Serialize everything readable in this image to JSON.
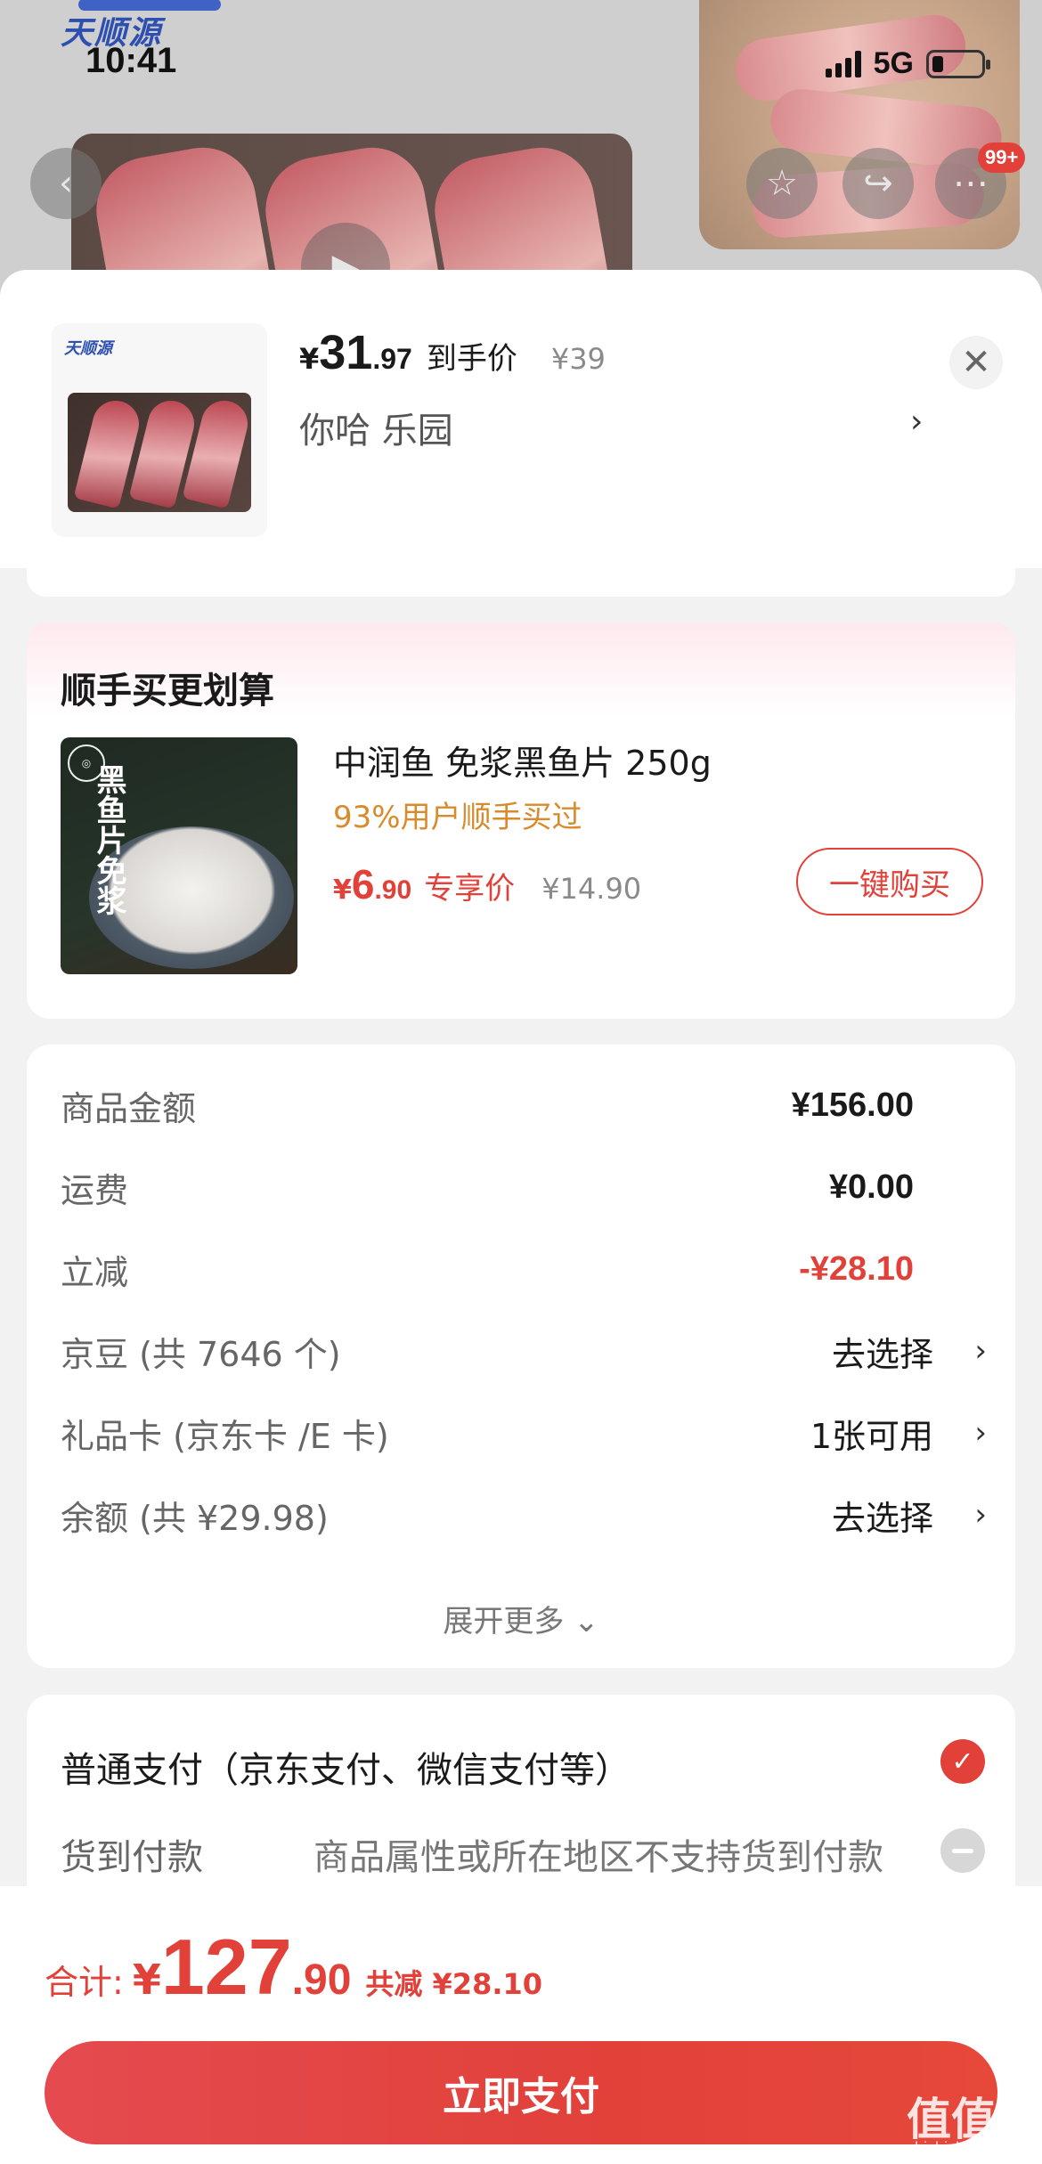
{
  "status_bar": {
    "time": "10:41",
    "network": "5G"
  },
  "background": {
    "brand_logo": "天顺源",
    "cart_badge": "99+"
  },
  "sheet_header": {
    "price_yen": "¥",
    "price_int": "31",
    "price_dec": ".97",
    "price_tag": "到手价",
    "original_price": "¥39",
    "spec": "你哈  乐园",
    "thumb_brand": "天顺源"
  },
  "upsell": {
    "title": "顺手买更划算",
    "product_name": "中润鱼 免浆黑鱼片 250g",
    "stat": "93%用户顺手买过",
    "price_yen": "¥",
    "price_int": "6",
    "price_dec": ".90",
    "price_tag": "专享价",
    "original_price": "¥14.90",
    "buy_button": "一键购买",
    "image_text": "黑鱼片免浆"
  },
  "summary": {
    "rows": [
      {
        "label": "商品金额",
        "value": "¥156.00"
      },
      {
        "label": "运费",
        "value": "¥0.00"
      },
      {
        "label": "立减",
        "value": "-¥28.10"
      },
      {
        "label": "京豆 (共 7646 个)",
        "value": "去选择"
      },
      {
        "label": "礼品卡 (京东卡 /E 卡)",
        "value": "1张可用"
      },
      {
        "label": "余额 (共 ¥29.98)",
        "value": "去选择"
      }
    ],
    "expand_label": "展开更多 ⌄"
  },
  "payment": {
    "option1": "普通支付（京东支付、微信支付等）",
    "option2_label": "货到付款",
    "option2_note": "商品属性或所在地区不支持货到付款"
  },
  "footer": {
    "total_label": "合计:",
    "total_yen": "¥",
    "total_int": "127",
    "total_dec": ".90",
    "total_saved": "共减 ¥28.10",
    "pay_button": "立即支付"
  },
  "watermark": {
    "text": "值值值",
    "sub": "zhizhizhi.com"
  },
  "colors": {
    "accent": "#e2413a",
    "orange": "#d98a2b",
    "muted": "#8a8a8a"
  },
  "icons": [
    "back-icon",
    "favorite-icon",
    "share-icon",
    "more-icon",
    "play-icon",
    "close-icon",
    "chevron-right-icon",
    "check-icon",
    "disabled-icon"
  ]
}
